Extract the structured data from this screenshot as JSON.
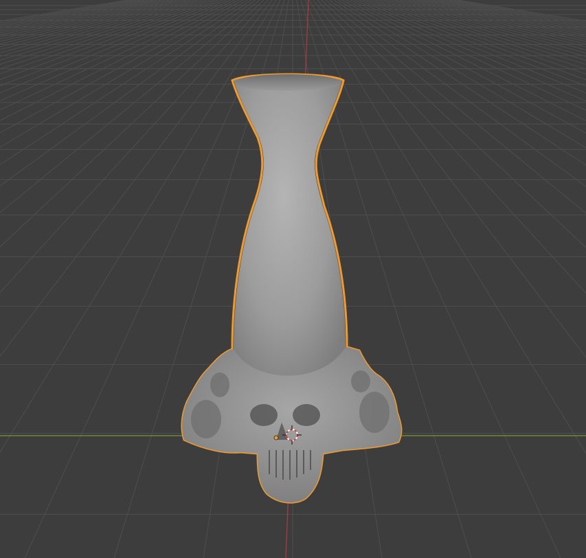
{
  "viewport": {
    "background_color": "#3d3d3d",
    "grid_color": "#4f4f4f",
    "x_axis_color": "#7a9a2f",
    "y_axis_color": "#b03a48"
  },
  "selected_object": {
    "type": "mesh",
    "description_icon": "vase-with-skulls-mesh",
    "outline_color": "#f39a2c",
    "material_color": "#9a9a9a",
    "origin_color": "#f39a2c"
  },
  "cursor_3d": {
    "icon": "crosshair-3d-cursor-icon",
    "colors": [
      "#e03a3a",
      "#ffffff"
    ]
  }
}
